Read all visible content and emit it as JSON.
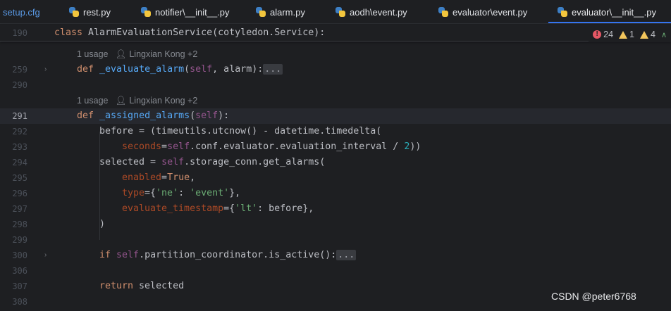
{
  "tabs": [
    {
      "label": "setup.cfg",
      "icon": "config-file-icon"
    },
    {
      "label": "rest.py",
      "icon": "python-file-icon"
    },
    {
      "label": "notifier\\__init__.py",
      "icon": "python-file-icon"
    },
    {
      "label": "alarm.py",
      "icon": "python-file-icon"
    },
    {
      "label": "aodh\\event.py",
      "icon": "python-file-icon"
    },
    {
      "label": "evaluator\\event.py",
      "icon": "python-file-icon"
    },
    {
      "label": "evaluator\\__init__.py",
      "icon": "python-file-icon",
      "active": true
    }
  ],
  "inspections": {
    "errors": "24",
    "warnings": "1",
    "weak_warnings": "4"
  },
  "sticky": {
    "line_number": "190",
    "code": "class AlarmEvaluationService(cotyledon.Service):"
  },
  "inlays": [
    {
      "usages": "1 usage",
      "author": "Lingxian Kong +2"
    },
    {
      "usages": "1 usage",
      "author": "Lingxian Kong +2"
    }
  ],
  "line_numbers": {
    "l259": "259",
    "l290": "290",
    "l291": "291",
    "l292": "292",
    "l293": "293",
    "l294": "294",
    "l295": "295",
    "l296": "296",
    "l297": "297",
    "l298": "298",
    "l299": "299",
    "l300": "300",
    "l306": "306",
    "l307": "307",
    "l308": "308"
  },
  "code": {
    "l259_def": "def ",
    "l259_fn": "_evaluate_alarm",
    "l259_open": "(",
    "l259_self": "self",
    "l259_rest": ", alarm):",
    "l259_fold": "...",
    "l291_def": "def ",
    "l291_fn": "_assigned_alarms",
    "l291_open": "(",
    "l291_self": "self",
    "l291_rest": "):",
    "l292": "before = (timeutils.utcnow() - datetime.timedelta(",
    "l293_param": "seconds",
    "l293_eq": "=",
    "l293_self": "self",
    "l293_mid": ".conf.evaluator.evaluation_interval / ",
    "l293_num": "2",
    "l293_end": "))",
    "l294_a": "selected = ",
    "l294_self": "self",
    "l294_b": ".storage_conn.get_alarms(",
    "l295_param": "enabled",
    "l295_eq": "=",
    "l295_kw": "True",
    "l295_end": ",",
    "l296_param": "type",
    "l296_a": "={",
    "l296_s1": "'ne'",
    "l296_b": ": ",
    "l296_s2": "'event'",
    "l296_c": "},",
    "l297_param": "evaluate_timestamp",
    "l297_a": "={",
    "l297_s1": "'lt'",
    "l297_b": ": before},",
    "l298": ")",
    "l300_kw": "if ",
    "l300_self": "self",
    "l300_rest": ".partition_coordinator.is_active():",
    "l300_fold": "...",
    "l307_kw": "return ",
    "l307_rest": "selected"
  },
  "watermark": "CSDN @peter6768"
}
